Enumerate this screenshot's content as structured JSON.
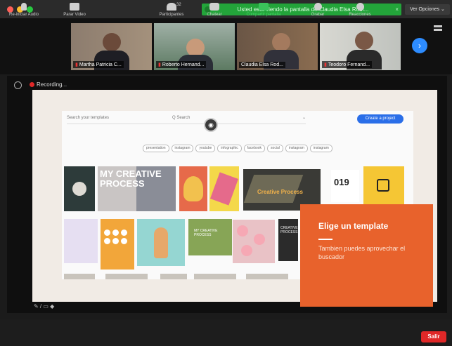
{
  "window": {
    "traffic_lights": [
      "#ff5f57",
      "#febc2e",
      "#28c840"
    ]
  },
  "share_banner": {
    "text": "Usted está viendo la pantalla de Claudia Elsa Rodr...",
    "close": "×"
  },
  "view_options_label": "Ver Opciones ⌄",
  "participants": [
    {
      "name": "Martha Patricia C..."
    },
    {
      "name": "Roberto Hernand..."
    },
    {
      "name": "Claudia Elsa Rod..."
    },
    {
      "name": "Teodoro Fernand..."
    }
  ],
  "next_arrow": "›",
  "recording_label": "Recording...",
  "canva": {
    "search_left": "Search your templates",
    "search_mid": "Q   Search",
    "create_button": "Create a project",
    "chips": [
      "presentation",
      "instagram",
      "youtube",
      "infographic",
      "facebook",
      "social",
      "instagram",
      "instagram"
    ],
    "card_titles": {
      "my_creative": "MY CREATIVE PROCESS",
      "creative_process": "Creative Process",
      "num_019": "019",
      "mi_creative": "MY CREATIVE PROCESS",
      "creative_process2": "CREATIVE PROCESS"
    }
  },
  "callout": {
    "heading": "Elige un template",
    "body": "Tambien puedes aprovechar el buscador"
  },
  "annotation_toolbar": "✎ / ▭ ◆",
  "toolbar": {
    "audio": "Re-iniciar Audio",
    "video": "Parar Video",
    "participants": "Participantes",
    "participants_count": "32",
    "chat": "Chatear",
    "share": "Compartir pantalla",
    "record": "Grabar",
    "reactions": "Reacciones",
    "leave": "Salir"
  }
}
